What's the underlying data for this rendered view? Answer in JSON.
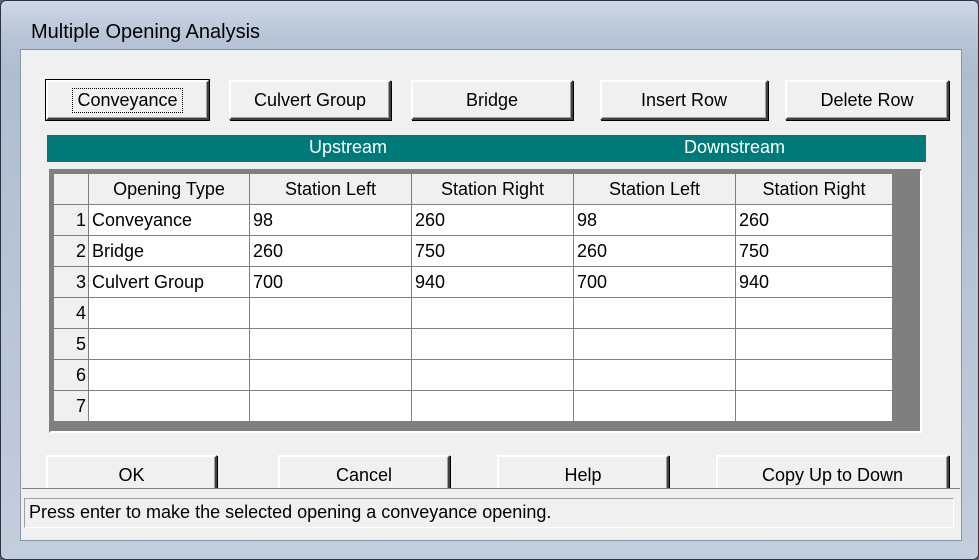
{
  "window": {
    "title": "Multiple Opening Analysis"
  },
  "toolbar": {
    "conveyance": "Conveyance",
    "culvert_group": "Culvert Group",
    "bridge": "Bridge",
    "insert_row": "Insert Row",
    "delete_row": "Delete Row"
  },
  "header": {
    "upstream": "Upstream",
    "downstream": "Downstream"
  },
  "table": {
    "columns": [
      "Opening Type",
      "Station Left",
      "Station Right",
      "Station Left",
      "Station Right"
    ],
    "rows": [
      {
        "num": "1",
        "type": "Conveyance",
        "us_left": "98",
        "us_right": "260",
        "ds_left": "98",
        "ds_right": "260"
      },
      {
        "num": "2",
        "type": "Bridge",
        "us_left": "260",
        "us_right": "750",
        "ds_left": "260",
        "ds_right": "750"
      },
      {
        "num": "3",
        "type": "Culvert Group",
        "us_left": "700",
        "us_right": "940",
        "ds_left": "700",
        "ds_right": "940"
      },
      {
        "num": "4",
        "type": "",
        "us_left": "",
        "us_right": "",
        "ds_left": "",
        "ds_right": ""
      },
      {
        "num": "5",
        "type": "",
        "us_left": "",
        "us_right": "",
        "ds_left": "",
        "ds_right": ""
      },
      {
        "num": "6",
        "type": "",
        "us_left": "",
        "us_right": "",
        "ds_left": "",
        "ds_right": ""
      },
      {
        "num": "7",
        "type": "",
        "us_left": "",
        "us_right": "",
        "ds_left": "",
        "ds_right": ""
      }
    ]
  },
  "footer": {
    "ok": "OK",
    "cancel": "Cancel",
    "help": "Help",
    "copy": "Copy Up to Down"
  },
  "status": "Press enter to make the selected opening a conveyance opening.",
  "colors": {
    "header_bar": "#007a78",
    "dialog_bg": "#f0f0f0"
  }
}
